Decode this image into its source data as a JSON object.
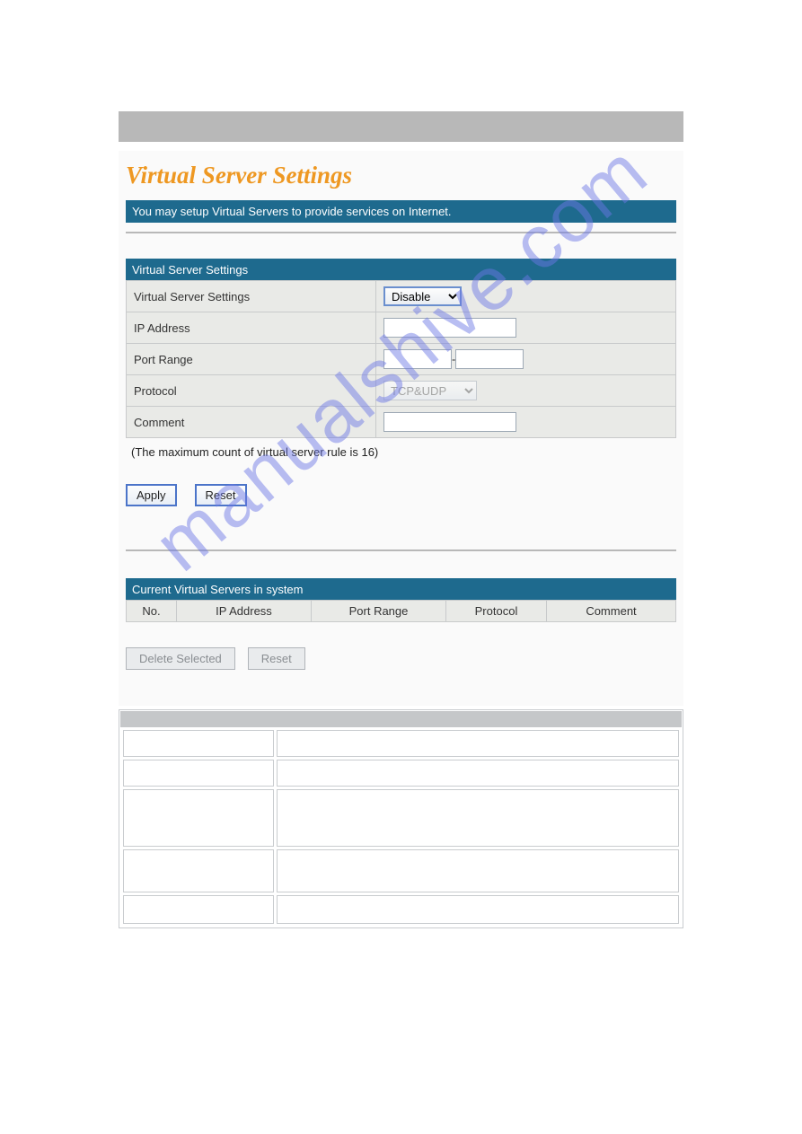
{
  "title": "Virtual Server Settings",
  "intro": "You may setup Virtual Servers to provide services on Internet.",
  "section1": {
    "header": "Virtual Server Settings",
    "rows": {
      "vserver_label": "Virtual Server Settings",
      "vserver_value": "Disable",
      "ip_label": "IP Address",
      "ip_value": "",
      "port_label": "Port Range",
      "port_from": "",
      "port_to": "",
      "port_sep": "-",
      "protocol_label": "Protocol",
      "protocol_value": "TCP&UDP",
      "comment_label": "Comment",
      "comment_value": ""
    },
    "note": "(The maximum count of virtual server rule is 16)",
    "apply": "Apply",
    "reset": "Reset"
  },
  "section2": {
    "header": "Current Virtual Servers in system",
    "columns": {
      "no": "No.",
      "ip": "IP Address",
      "port": "Port Range",
      "protocol": "Protocol",
      "comment": "Comment"
    },
    "delete": "Delete Selected",
    "reset": "Reset"
  },
  "watermark": "manualshive.com"
}
